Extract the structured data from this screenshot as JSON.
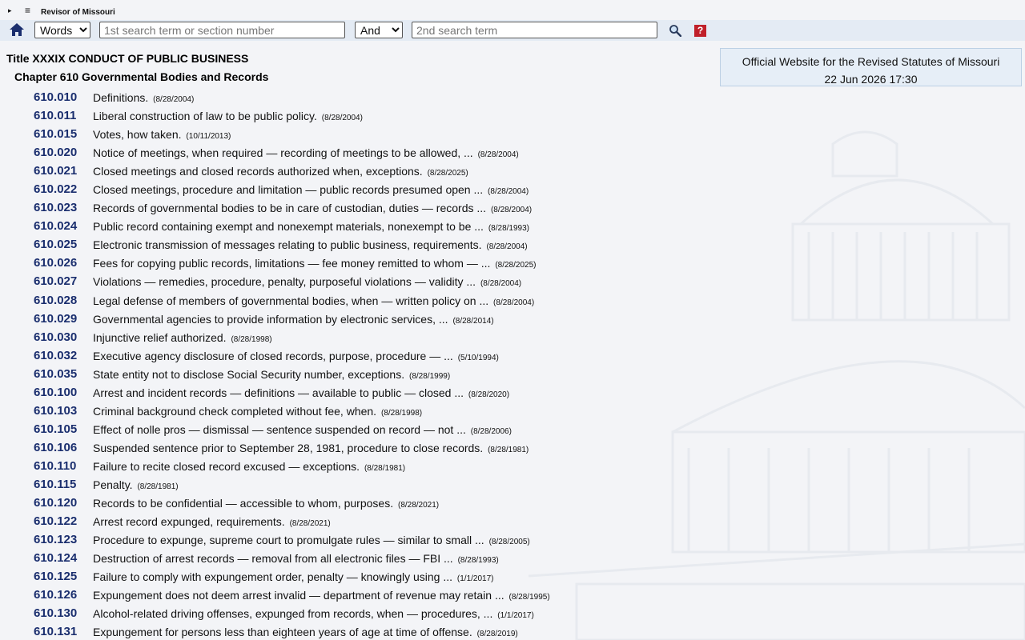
{
  "header": {
    "brand": "Revisor of Missouri",
    "expand_glyph": "▸",
    "menu_glyph": "≡"
  },
  "search": {
    "mode_options": [
      "Words"
    ],
    "mode_selected": "Words",
    "term1_placeholder": "1st search term or section number",
    "term1_value": "",
    "operator_options": [
      "And"
    ],
    "operator_selected": "And",
    "term2_placeholder": "2nd search term",
    "term2_value": "",
    "help_label": "?"
  },
  "title": "Title XXXIX CONDUCT OF PUBLIC BUSINESS",
  "chapter": "Chapter 610 Governmental Bodies and Records",
  "info": {
    "line1": "Official Website for the Revised Statutes of Missouri",
    "line2": "22 Jun 2026 17:30"
  },
  "sections": [
    {
      "num": "610.010",
      "desc": "Definitions.",
      "date": "(8/28/2004)"
    },
    {
      "num": "610.011",
      "desc": "Liberal construction of law to be public policy.",
      "date": "(8/28/2004)"
    },
    {
      "num": "610.015",
      "desc": "Votes, how taken.",
      "date": "(10/11/2013)"
    },
    {
      "num": "610.020",
      "desc": "Notice of meetings, when required — recording of meetings to be allowed, ...",
      "date": "(8/28/2004)"
    },
    {
      "num": "610.021",
      "desc": "Closed meetings and closed records authorized when, exceptions.",
      "date": "(8/28/2025)"
    },
    {
      "num": "610.022",
      "desc": "Closed meetings, procedure and limitation — public records presumed open ...",
      "date": "(8/28/2004)"
    },
    {
      "num": "610.023",
      "desc": "Records of governmental bodies to be in care of custodian, duties — records ...",
      "date": "(8/28/2004)"
    },
    {
      "num": "610.024",
      "desc": "Public record containing exempt and nonexempt materials, nonexempt to be ...",
      "date": "(8/28/1993)"
    },
    {
      "num": "610.025",
      "desc": "Electronic transmission of messages relating to public business, requirements.",
      "date": "(8/28/2004)"
    },
    {
      "num": "610.026",
      "desc": "Fees for copying public records, limitations — fee money remitted to whom — ...",
      "date": "(8/28/2025)"
    },
    {
      "num": "610.027",
      "desc": "Violations — remedies, procedure, penalty, purposeful violations — validity ...",
      "date": "(8/28/2004)"
    },
    {
      "num": "610.028",
      "desc": "Legal defense of members of governmental bodies, when — written policy on ...",
      "date": "(8/28/2004)"
    },
    {
      "num": "610.029",
      "desc": "Governmental agencies to provide information by electronic services, ...",
      "date": "(8/28/2014)"
    },
    {
      "num": "610.030",
      "desc": "Injunctive relief authorized.",
      "date": "(8/28/1998)"
    },
    {
      "num": "610.032",
      "desc": "Executive agency disclosure of closed records, purpose, procedure — ...",
      "date": "(5/10/1994)"
    },
    {
      "num": "610.035",
      "desc": "State entity not to disclose Social Security number, exceptions.",
      "date": "(8/28/1999)"
    },
    {
      "num": "610.100",
      "desc": "Arrest and incident records — definitions — available to public — closed ...",
      "date": "(8/28/2020)"
    },
    {
      "num": "610.103",
      "desc": "Criminal background check completed without fee, when.",
      "date": "(8/28/1998)"
    },
    {
      "num": "610.105",
      "desc": "Effect of nolle pros — dismissal — sentence suspended on record — not ...",
      "date": "(8/28/2006)"
    },
    {
      "num": "610.106",
      "desc": "Suspended sentence prior to September 28, 1981, procedure to close records.",
      "date": "(8/28/1981)"
    },
    {
      "num": "610.110",
      "desc": "Failure to recite closed record excused — exceptions.",
      "date": "(8/28/1981)"
    },
    {
      "num": "610.115",
      "desc": "Penalty.",
      "date": "(8/28/1981)"
    },
    {
      "num": "610.120",
      "desc": "Records to be confidential — accessible to whom, purposes.",
      "date": "(8/28/2021)"
    },
    {
      "num": "610.122",
      "desc": "Arrest record expunged, requirements.",
      "date": "(8/28/2021)"
    },
    {
      "num": "610.123",
      "desc": "Procedure to expunge, supreme court to promulgate rules — similar to small ...",
      "date": "(8/28/2005)"
    },
    {
      "num": "610.124",
      "desc": "Destruction of arrest records — removal from all electronic files — FBI ...",
      "date": "(8/28/1993)"
    },
    {
      "num": "610.125",
      "desc": "Failure to comply with expungement order, penalty — knowingly using ...",
      "date": "(1/1/2017)"
    },
    {
      "num": "610.126",
      "desc": "Expungement does not deem arrest invalid — department of revenue may retain ...",
      "date": "(8/28/1995)"
    },
    {
      "num": "610.130",
      "desc": "Alcohol-related driving offenses, expunged from records, when — procedures, ...",
      "date": "(1/1/2017)"
    },
    {
      "num": "610.131",
      "desc": "Expungement for persons less than eighteen years of age at time of offense.",
      "date": "(8/28/2019)"
    }
  ]
}
